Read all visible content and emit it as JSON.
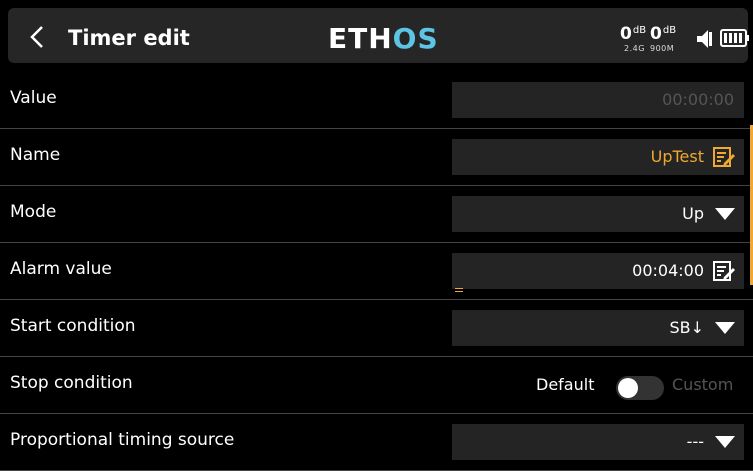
{
  "header": {
    "back_icon": "chevron-left-icon",
    "title": "Timer edit",
    "logo_part1": "ETH",
    "logo_part2": "OS",
    "rssi_24": "0",
    "rssi_900": "0",
    "db_unit": "dB",
    "band_24": "2.4G",
    "band_900": "900M",
    "speaker_icon": "speaker-icon",
    "battery_icon": "battery-icon",
    "logo_colors": {
      "white": "#ffffff",
      "blue": "#5ec4e6"
    }
  },
  "rows": {
    "value": {
      "label": "Value",
      "value": "00:00:00"
    },
    "name": {
      "label": "Name",
      "value": "UpTest",
      "icon": "edit-icon"
    },
    "mode": {
      "label": "Mode",
      "value": "Up",
      "icon": "dropdown-arrow-icon"
    },
    "alarm": {
      "label": "Alarm value",
      "value": "00:04:00",
      "icon": "edit-icon"
    },
    "start": {
      "label": "Start condition",
      "value": "SB↓",
      "icon": "dropdown-arrow-icon"
    },
    "stop": {
      "label": "Stop condition",
      "option_left": "Default",
      "option_right": "Custom",
      "state": "Default"
    },
    "proportional": {
      "label": "Proportional timing source",
      "value": "---",
      "icon": "dropdown-arrow-icon"
    }
  },
  "colors": {
    "accent": "#f0a830",
    "field_bg": "#242424",
    "disabled": "#555555"
  }
}
